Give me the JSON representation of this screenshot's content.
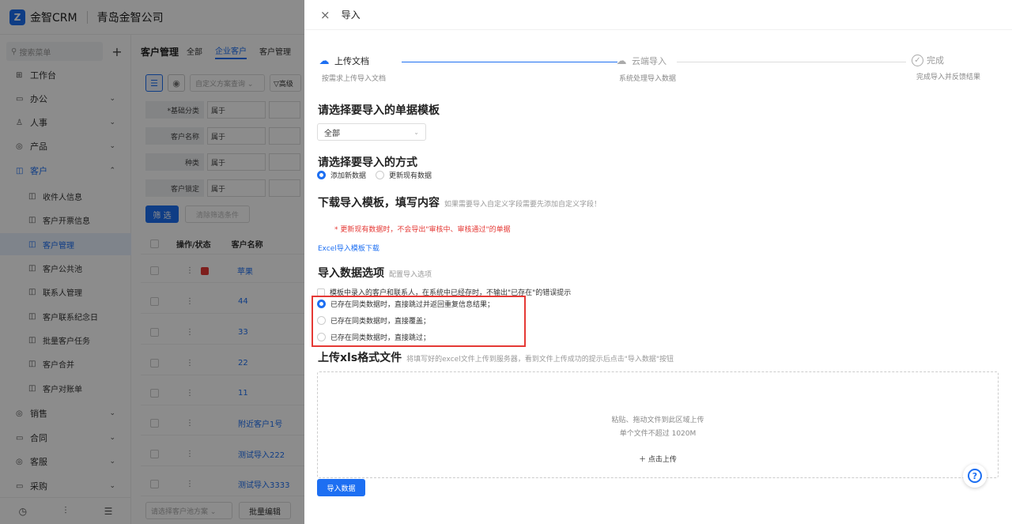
{
  "header": {
    "logo_letter": "Z",
    "app_name": "金智CRM",
    "company": "青岛金智公司"
  },
  "sidebar": {
    "search_placeholder": "搜索菜单",
    "plus": "+",
    "items": [
      {
        "label": "工作台",
        "icon": "⊞",
        "arrow": ""
      },
      {
        "label": "办公",
        "icon": "▭",
        "arrow": "⌄"
      },
      {
        "label": "人事",
        "icon": "♙",
        "arrow": "⌄"
      },
      {
        "label": "产品",
        "icon": "◎",
        "arrow": "⌄"
      },
      {
        "label": "客户",
        "icon": "◫",
        "arrow": "⌃"
      },
      {
        "label": "收件人信息",
        "icon": "◫"
      },
      {
        "label": "客户开票信息",
        "icon": "◫"
      },
      {
        "label": "客户管理",
        "icon": "◫"
      },
      {
        "label": "客户公共池",
        "icon": "◫"
      },
      {
        "label": "联系人管理",
        "icon": "◫"
      },
      {
        "label": "客户联系纪念日",
        "icon": "◫"
      },
      {
        "label": "批量客户任务",
        "icon": "◫"
      },
      {
        "label": "客户合并",
        "icon": "◫"
      },
      {
        "label": "客户对账单",
        "icon": "◫"
      },
      {
        "label": "销售",
        "icon": "◎",
        "arrow": "⌄"
      },
      {
        "label": "合同",
        "icon": "▭",
        "arrow": "⌄"
      },
      {
        "label": "客服",
        "icon": "◎",
        "arrow": "⌄"
      },
      {
        "label": "采购",
        "icon": "▭",
        "arrow": "⌄"
      }
    ],
    "bottom_icons": [
      "◷",
      "⫶",
      "☰"
    ]
  },
  "main": {
    "title": "客户管理",
    "tabs": [
      "全部",
      "企业客户",
      "客户管理"
    ],
    "tool_list_icon": "☰",
    "tool_loc_icon": "◉",
    "custom_plan": "自定义方案查询 ⌄",
    "advanced": "▽高级",
    "filters": [
      {
        "label": "*基础分类",
        "op": "属于"
      },
      {
        "label": "客户名称",
        "op": "属于"
      },
      {
        "label": "种类",
        "op": "属于"
      },
      {
        "label": "客户锁定",
        "op": "属于"
      }
    ],
    "filter_btn": "筛 选",
    "clear_btn": "清除筛选条件",
    "table_head": {
      "ops": "操作/状态",
      "name": "客户名称"
    },
    "rows": [
      {
        "ops": "⋮",
        "name": "苹果",
        "flag": true
      },
      {
        "ops": "⋮",
        "name": "44",
        "flag": false
      },
      {
        "ops": "⋮",
        "name": "33",
        "flag": false
      },
      {
        "ops": "⋮",
        "name": "22",
        "flag": false
      },
      {
        "ops": "⋮",
        "name": "11",
        "flag": false
      },
      {
        "ops": "⋮",
        "name": "附近客户1号",
        "flag": false
      },
      {
        "ops": "⋮",
        "name": "测试导入222",
        "flag": false
      },
      {
        "ops": "⋮",
        "name": "测试导入3333",
        "flag": false
      }
    ],
    "bottom_select": "请选择客户池方案 ⌄",
    "bottom_btn": "批量编辑"
  },
  "drawer": {
    "close": "×",
    "title": "导入",
    "steps": [
      {
        "title": "上传文档",
        "desc": "按需求上传导入文档",
        "icon": "☁",
        "state": "done"
      },
      {
        "title": "云端导入",
        "desc": "系统处理导入数据",
        "icon": "☁",
        "state": "wait"
      },
      {
        "title": "完成",
        "desc": "完成导入并反馈结果",
        "icon": "✓",
        "state": "wait"
      }
    ],
    "template_section": {
      "title": "请选择要导入的单据模板",
      "selected": "全部"
    },
    "method_section": {
      "title": "请选择要导入的方式",
      "options": [
        {
          "label": "添加新数据",
          "checked": true
        },
        {
          "label": "更新现有数据",
          "checked": false
        }
      ]
    },
    "download_section": {
      "title": "下载导入模板，填写内容",
      "hint": "如果需要导入自定义字段需要先添加自定义字段！",
      "warning": "* 更新现有数据时，不会导出\"审核中、审核通过\"的单据",
      "link": "Excel导入模板下载"
    },
    "options_section": {
      "title": "导入数据选项",
      "hint": "配置导入选项",
      "checkbox_label": "模板中录入的客户和联系人，在系统中已经存时，不输出\"已存在\"的错误提示",
      "radios": [
        {
          "label": "已存在同类数据时，直接跳过并返回重复信息结果；",
          "checked": true
        },
        {
          "label": "已存在同类数据时，直接覆盖；",
          "checked": false
        },
        {
          "label": "已存在同类数据时，直接跳过；",
          "checked": false
        }
      ]
    },
    "upload_section": {
      "title": "上传xls格式文件",
      "hint": "将填写好的excel文件上传到服务器，看到文件上传成功的提示后点击\"导入数据\"按钮",
      "drop_text": "粘贴、拖动文件到此区域上传",
      "size_text": "单个文件不超过 1020M",
      "button": "＋ 点击上传"
    },
    "import_button": "导入数据",
    "help_icon": "?"
  },
  "colors": {
    "primary": "#1d6ff2",
    "danger": "#e53935",
    "overlay": "rgba(0,0,0,0.45)"
  }
}
